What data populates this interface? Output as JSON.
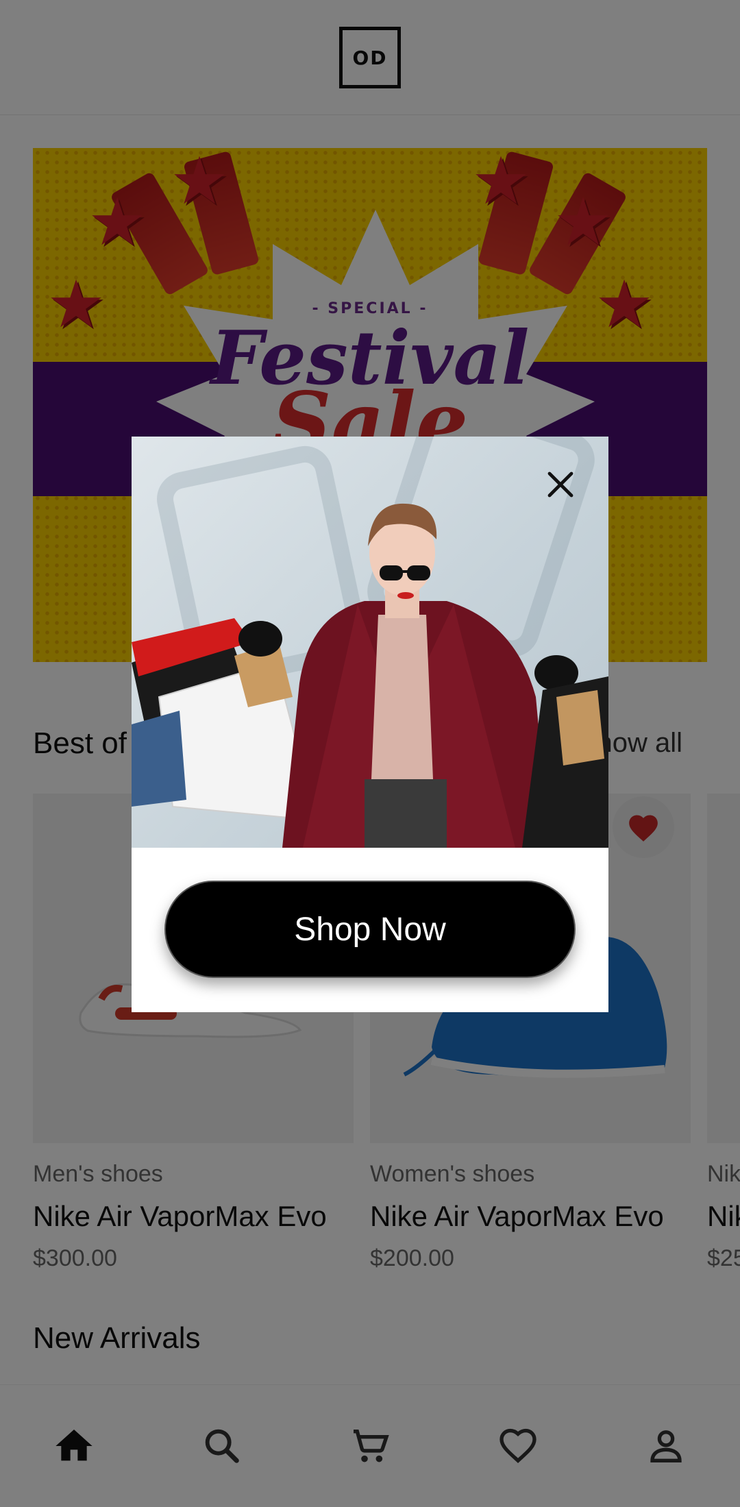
{
  "header": {
    "logo_text": "OD"
  },
  "banner": {
    "special": "- SPECIAL -",
    "festival": "Festival",
    "sale": "Sale"
  },
  "best_of": {
    "title": "Best of",
    "show_all": "Show all",
    "products": [
      {
        "category": "Men's shoes",
        "name": "Nike Air VaporMax Evo",
        "price": "$300.00"
      },
      {
        "category": "Women's shoes",
        "name": "Nike Air VaporMax Evo",
        "price": "$200.00"
      },
      {
        "category": "Nike",
        "name": "Nike",
        "price": "$25"
      }
    ]
  },
  "new_arrivals": {
    "title": "New Arrivals"
  },
  "bottom_nav": {
    "items": [
      "home-icon",
      "search-icon",
      "cart-icon",
      "heart-icon",
      "person-icon"
    ]
  },
  "popup": {
    "cta_label": "Shop Now"
  },
  "colors": {
    "overlay": "rgba(0,0,0,0.5)",
    "accent_red": "#c62828",
    "button": "#000000"
  }
}
